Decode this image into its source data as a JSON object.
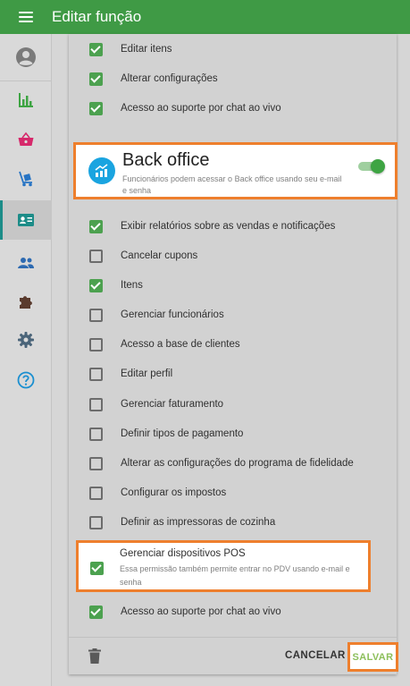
{
  "header": {
    "title": "Editar função"
  },
  "colors": {
    "primary": "#3f9a45",
    "highlight": "#ee7f2d",
    "checkbox_on": "#4ca14f",
    "accent": "#1c8c88"
  },
  "sidebar": {
    "items": [
      {
        "name": "avatar-icon",
        "active": false
      },
      {
        "name": "reports-icon",
        "active": false
      },
      {
        "name": "basket-icon",
        "active": false
      },
      {
        "name": "inventory-icon",
        "active": false
      },
      {
        "name": "employee-card-icon",
        "active": true
      },
      {
        "name": "customers-icon",
        "active": false
      },
      {
        "name": "integrations-icon",
        "active": false
      },
      {
        "name": "settings-icon",
        "active": false
      },
      {
        "name": "help-icon",
        "active": false
      }
    ]
  },
  "pos_section": {
    "items": [
      {
        "label": "Editar itens",
        "checked": true
      },
      {
        "label": "Alterar configurações",
        "checked": true
      },
      {
        "label": "Acesso ao suporte por chat ao vivo",
        "checked": true
      }
    ]
  },
  "back_office": {
    "title": "Back office",
    "subtitle": "Funcionários podem acessar o Back office usando seu e-mail e senha",
    "enabled": true,
    "items": [
      {
        "label": "Exibir relatórios sobre as vendas e notificações",
        "checked": true
      },
      {
        "label": "Cancelar cupons",
        "checked": false
      },
      {
        "label": "Itens",
        "checked": true
      },
      {
        "label": "Gerenciar funcionários",
        "checked": false
      },
      {
        "label": "Acesso a base de clientes",
        "checked": false
      },
      {
        "label": "Editar perfil",
        "checked": false
      },
      {
        "label": "Gerenciar faturamento",
        "checked": false
      },
      {
        "label": "Definir tipos de pagamento",
        "checked": false
      },
      {
        "label": "Alterar as configurações do programa de fidelidade",
        "checked": false
      },
      {
        "label": "Configurar os impostos",
        "checked": false
      },
      {
        "label": "Definir as impressoras de cozinha",
        "checked": false
      }
    ],
    "manage_pos": {
      "label": "Gerenciar dispositivos POS",
      "subtitle": "Essa permissão também permite entrar no PDV usando e-mail e senha",
      "checked": true
    },
    "last_item": {
      "label": "Acesso ao suporte por chat ao vivo",
      "checked": true
    }
  },
  "footer": {
    "delete_icon": "trash-icon",
    "cancel_label": "CANCELAR",
    "save_label": "SALVAR"
  }
}
